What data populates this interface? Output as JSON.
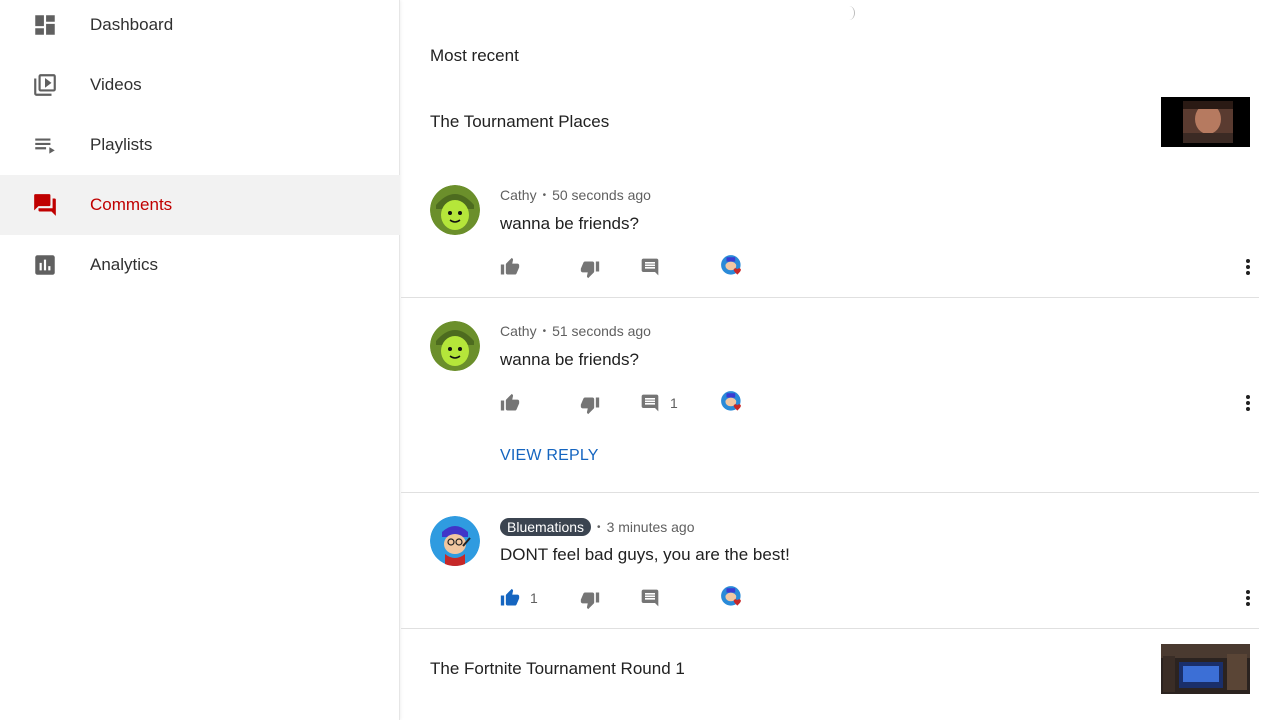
{
  "sidebar": {
    "items": [
      {
        "label": "Dashboard",
        "icon": "dashboard-icon"
      },
      {
        "label": "Videos",
        "icon": "videos-icon"
      },
      {
        "label": "Playlists",
        "icon": "playlists-icon"
      },
      {
        "label": "Comments",
        "icon": "comments-icon",
        "active": true
      },
      {
        "label": "Analytics",
        "icon": "analytics-icon"
      }
    ]
  },
  "main": {
    "sort_label": "Most recent",
    "groups": [
      {
        "video_title": "The Tournament Places",
        "comments": [
          {
            "author": "Cathy",
            "time": "50 seconds ago",
            "text": "wanna be friends?",
            "likes": "",
            "replies": ""
          },
          {
            "author": "Cathy",
            "time": "51 seconds ago",
            "text": "wanna be friends?",
            "likes": "",
            "replies": "1",
            "view_reply": "VIEW REPLY"
          },
          {
            "author": "Bluemations",
            "time": "3 minutes ago",
            "text": "DONT feel bad guys, you are the best!",
            "likes": "1",
            "replies": "",
            "is_owner": true
          }
        ]
      },
      {
        "video_title": "The Fortnite Tournament Round 1",
        "comments": []
      }
    ]
  },
  "colors": {
    "active_nav": "#c00000",
    "link_blue": "#1565c0",
    "liked_blue": "#1565c0",
    "heart_red": "#c62828"
  }
}
